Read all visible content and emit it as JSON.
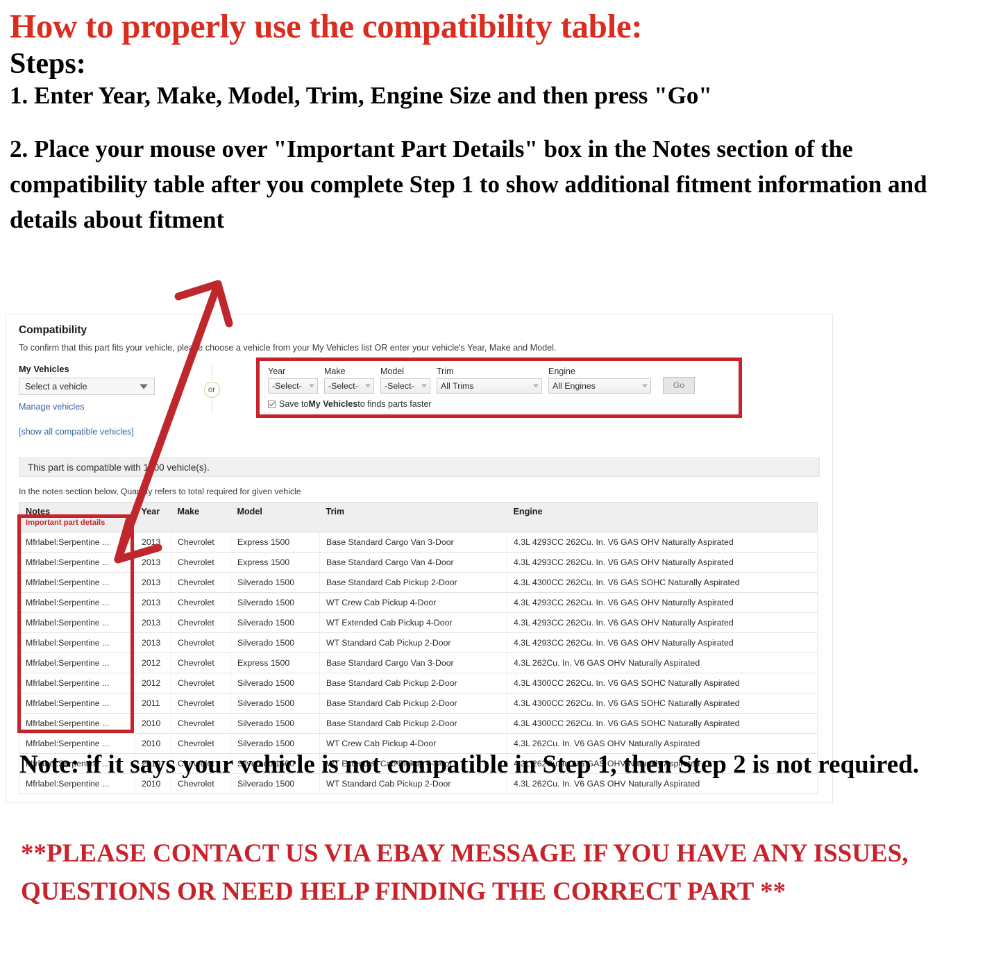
{
  "instructions": {
    "title": "How to properly use the compatibility table:",
    "steps_label": "Steps:",
    "step_1": "1. Enter Year, Make, Model, Trim, Engine Size and then press \"Go\"",
    "step_2": "2. Place your mouse over \"Important Part Details\" box in the Notes section of the compatibility table after you complete Step 1 to show additional fitment information and details about fitment",
    "bottom_note": "Note: if it says your vehicle is not compatible in Step 1, then Step 2 is not required.",
    "contact_note": "**PLEASE CONTACT US VIA EBAY MESSAGE IF YOU HAVE ANY ISSUES, QUESTIONS OR NEED HELP FINDING THE CORRECT PART **",
    "title_color": "#d92d20",
    "highlight_color": "#c8222a"
  },
  "compatibility": {
    "heading": "Compatibility",
    "subtext": "To confirm that this part fits your vehicle, please choose a vehicle from your My Vehicles list OR enter your vehicle's Year, Make and Model.",
    "my_vehicles": {
      "label": "My Vehicles",
      "select_value": "Select a vehicle",
      "manage_link": "Manage vehicles",
      "show_all_link": "[show all compatible vehicles]"
    },
    "or_text": "or",
    "selector": {
      "year_label": "Year",
      "year_value": "-Select-",
      "make_label": "Make",
      "make_value": "-Select-",
      "model_label": "Model",
      "model_value": "-Select-",
      "trim_label": "Trim",
      "trim_value": "All Trims",
      "engine_label": "Engine",
      "engine_value": "All Engines",
      "go_label": "Go",
      "save_prefix": "Save to ",
      "save_bold": "My Vehicles",
      "save_suffix": " to finds parts faster"
    },
    "count_text": "This part is compatible with 1000 vehicle(s).",
    "quantity_note": "In the notes section below, Quantity refers to total required for given vehicle"
  },
  "fitment_table": {
    "columns": [
      "Notes",
      "Year",
      "Make",
      "Model",
      "Trim",
      "Engine"
    ],
    "notes_subheader": "Important part details",
    "rows": [
      {
        "notes": "Mfrlabel:Serpentine ...",
        "year": "2013",
        "make": "Chevrolet",
        "model": "Express 1500",
        "trim": "Base Standard Cargo Van 3-Door",
        "engine": "4.3L 4293CC 262Cu. In. V6 GAS OHV Naturally Aspirated"
      },
      {
        "notes": "Mfrlabel:Serpentine ...",
        "year": "2013",
        "make": "Chevrolet",
        "model": "Express 1500",
        "trim": "Base Standard Cargo Van 4-Door",
        "engine": "4.3L 4293CC 262Cu. In. V6 GAS OHV Naturally Aspirated"
      },
      {
        "notes": "Mfrlabel:Serpentine ...",
        "year": "2013",
        "make": "Chevrolet",
        "model": "Silverado 1500",
        "trim": "Base Standard Cab Pickup 2-Door",
        "engine": "4.3L 4300CC 262Cu. In. V6 GAS SOHC Naturally Aspirated"
      },
      {
        "notes": "Mfrlabel:Serpentine ...",
        "year": "2013",
        "make": "Chevrolet",
        "model": "Silverado 1500",
        "trim": "WT Crew Cab Pickup 4-Door",
        "engine": "4.3L 4293CC 262Cu. In. V6 GAS OHV Naturally Aspirated"
      },
      {
        "notes": "Mfrlabel:Serpentine ...",
        "year": "2013",
        "make": "Chevrolet",
        "model": "Silverado 1500",
        "trim": "WT Extended Cab Pickup 4-Door",
        "engine": "4.3L 4293CC 262Cu. In. V6 GAS OHV Naturally Aspirated"
      },
      {
        "notes": "Mfrlabel:Serpentine ...",
        "year": "2013",
        "make": "Chevrolet",
        "model": "Silverado 1500",
        "trim": "WT Standard Cab Pickup 2-Door",
        "engine": "4.3L 4293CC 262Cu. In. V6 GAS OHV Naturally Aspirated"
      },
      {
        "notes": "Mfrlabel:Serpentine ...",
        "year": "2012",
        "make": "Chevrolet",
        "model": "Express 1500",
        "trim": "Base Standard Cargo Van 3-Door",
        "engine": "4.3L 262Cu. In. V6 GAS OHV Naturally Aspirated"
      },
      {
        "notes": "Mfrlabel:Serpentine ...",
        "year": "2012",
        "make": "Chevrolet",
        "model": "Silverado 1500",
        "trim": "Base Standard Cab Pickup 2-Door",
        "engine": "4.3L 4300CC 262Cu. In. V6 GAS SOHC Naturally Aspirated"
      },
      {
        "notes": "Mfrlabel:Serpentine ...",
        "year": "2011",
        "make": "Chevrolet",
        "model": "Silverado 1500",
        "trim": "Base Standard Cab Pickup 2-Door",
        "engine": "4.3L 4300CC 262Cu. In. V6 GAS SOHC Naturally Aspirated"
      },
      {
        "notes": "Mfrlabel:Serpentine ...",
        "year": "2010",
        "make": "Chevrolet",
        "model": "Silverado 1500",
        "trim": "Base Standard Cab Pickup 2-Door",
        "engine": "4.3L 4300CC 262Cu. In. V6 GAS SOHC Naturally Aspirated"
      },
      {
        "notes": "Mfrlabel:Serpentine ...",
        "year": "2010",
        "make": "Chevrolet",
        "model": "Silverado 1500",
        "trim": "WT Crew Cab Pickup 4-Door",
        "engine": "4.3L 262Cu. In. V6 GAS OHV Naturally Aspirated"
      },
      {
        "notes": "Mfrlabel:Serpentine ...",
        "year": "2010",
        "make": "Chevrolet",
        "model": "Silverado 1500",
        "trim": "WT Extended Cab Pickup 4-Door",
        "engine": "4.3L 262Cu. In. V6 GAS OHV Naturally Aspirated"
      },
      {
        "notes": "Mfrlabel:Serpentine ...",
        "year": "2010",
        "make": "Chevrolet",
        "model": "Silverado 1500",
        "trim": "WT Standard Cab Pickup 2-Door",
        "engine": "4.3L 262Cu. In. V6 GAS OHV Naturally Aspirated"
      }
    ]
  }
}
